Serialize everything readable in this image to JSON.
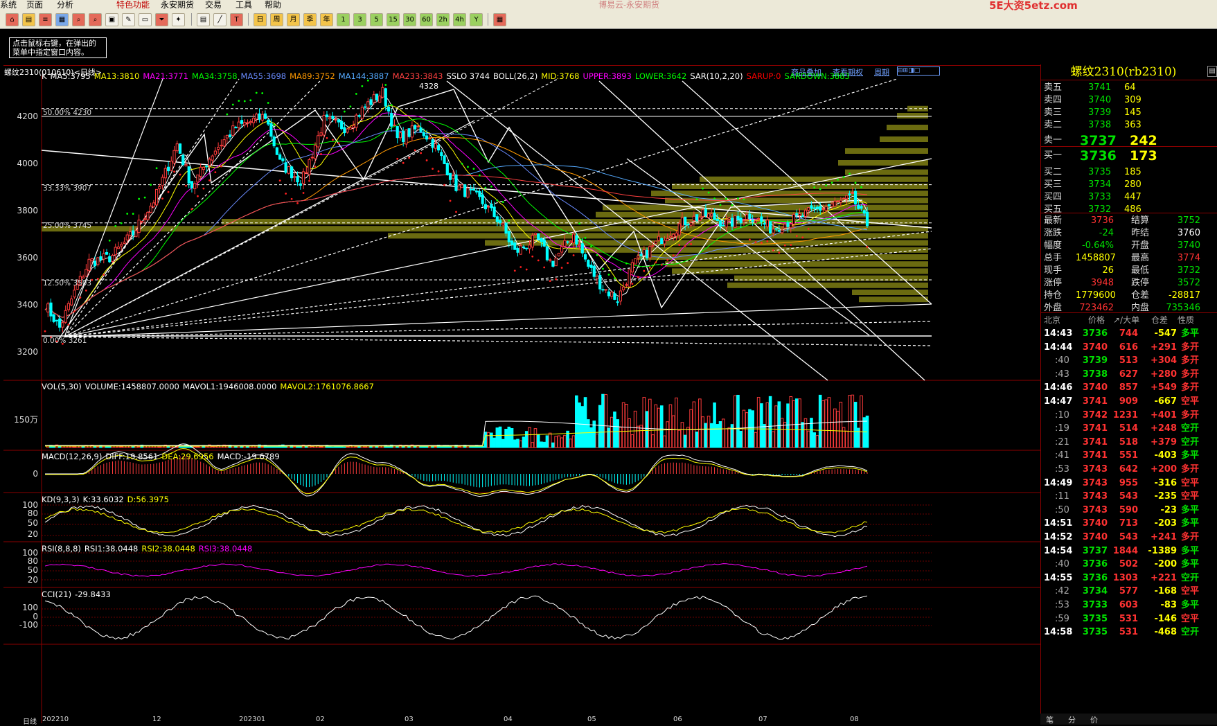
{
  "menu": [
    "系统",
    "页面",
    "分析",
    "特色功能",
    "永安期货",
    "交易",
    "工具",
    "帮助"
  ],
  "app_title": "博易云-永安期货",
  "watermark": "5E大资5etz.com",
  "toolbar_period_buttons": [
    "日",
    "周",
    "月",
    "季",
    "年",
    "1",
    "3",
    "5",
    "15",
    "30",
    "60",
    "2h",
    "4h",
    "Y"
  ],
  "hint": "点击鼠标右键，在弹出的菜单中指定窗口内容。",
  "chart_header": {
    "symbol": "螺纹2310(010610)<日线>",
    "links": [
      "商品叠加",
      "查看期权",
      "周期"
    ]
  },
  "main_indicators": [
    {
      "text": "K",
      "color": "#ffffff"
    },
    {
      "text": "MA5:3795",
      "color": "#ffffff"
    },
    {
      "text": "MA13:3810",
      "color": "#ffff00"
    },
    {
      "text": "MA21:3771",
      "color": "#ff00ff"
    },
    {
      "text": "MA34:3758",
      "color": "#00ff00"
    },
    {
      "text": "MA55:3698",
      "color": "#6a8cff"
    },
    {
      "text": "MA89:3752",
      "color": "#ff9900"
    },
    {
      "text": "MA144:3887",
      "color": "#55aaff"
    },
    {
      "text": "MA233:3843",
      "color": "#ff4040"
    },
    {
      "text": "SSLO 3744",
      "color": "#ffffff"
    },
    {
      "text": "BOLL(26,2)",
      "color": "#ffffff"
    },
    {
      "text": "MID:3768",
      "color": "#ffff00"
    },
    {
      "text": "UPPER:3893",
      "color": "#ff00ff"
    },
    {
      "text": "LOWER:3642",
      "color": "#00ff00"
    },
    {
      "text": "SAR(10,2,20)",
      "color": "#ffffff"
    },
    {
      "text": "SARUP:0",
      "color": "#ff0000"
    },
    {
      "text": "SARDOWN:3883",
      "color": "#00ff00"
    }
  ],
  "price_axis": [
    "4200",
    "4000",
    "3800",
    "3600",
    "3400",
    "3200"
  ],
  "fib_labels": [
    {
      "text": "50.00%  4230"
    },
    {
      "text": "33.33%  3907"
    },
    {
      "text": "25.00%  3745"
    },
    {
      "text": "12.50%  3503"
    },
    {
      "text": "0.00%   3261"
    }
  ],
  "peak_label": "4328",
  "volume": {
    "legend": [
      {
        "text": "VOL(5,30)",
        "color": "#ffffff"
      },
      {
        "text": "VOLUME:1458807.0000",
        "color": "#ffffff"
      },
      {
        "text": "MAVOL1:1946008.0000",
        "color": "#ffffff"
      },
      {
        "text": "MAVOL2:1761076.8667",
        "color": "#ffff00"
      }
    ],
    "axis": "150万"
  },
  "macd": {
    "legend": [
      {
        "text": "MACD(12,26,9)",
        "color": "#ffffff"
      },
      {
        "text": "DIFF:19.8561",
        "color": "#ffffff"
      },
      {
        "text": "DEA:29.6956",
        "color": "#ffff00"
      },
      {
        "text": "MACD:-19.6789",
        "color": "#ffffff"
      }
    ],
    "axis": "0"
  },
  "kd": {
    "legend": [
      {
        "text": "KD(9,3,3)",
        "color": "#ffffff"
      },
      {
        "text": "K:33.6032",
        "color": "#ffffff"
      },
      {
        "text": "D:56.3975",
        "color": "#ffff00"
      }
    ],
    "axis": [
      "100",
      "80",
      "50",
      "20"
    ]
  },
  "rsi": {
    "legend": [
      {
        "text": "RSI(8,8,8)",
        "color": "#ffffff"
      },
      {
        "text": "RSI1:38.0448",
        "color": "#ffffff"
      },
      {
        "text": "RSI2:38.0448",
        "color": "#ffff00"
      },
      {
        "text": "RSI3:38.0448",
        "color": "#ff00ff"
      }
    ],
    "axis": [
      "100",
      "80",
      "50",
      "20"
    ]
  },
  "cci": {
    "legend": [
      {
        "text": "CCI(21)",
        "color": "#ffffff"
      },
      {
        "text": "-29.8433",
        "color": "#ffffff"
      }
    ],
    "axis": [
      "100",
      "0",
      "-100"
    ]
  },
  "time_axis": [
    "日线",
    "202210",
    "12",
    "202301",
    "02",
    "03",
    "04",
    "05",
    "06",
    "07",
    "08"
  ],
  "quote": {
    "title": "螺纹2310(rb2310)",
    "asks": [
      {
        "label": "卖五",
        "price": "3741",
        "vol": "64"
      },
      {
        "label": "卖四",
        "price": "3740",
        "vol": "309"
      },
      {
        "label": "卖三",
        "price": "3739",
        "vol": "145"
      },
      {
        "label": "卖二",
        "price": "3738",
        "vol": "363"
      },
      {
        "label": "卖一",
        "price": "3737",
        "vol": "242"
      }
    ],
    "bids": [
      {
        "label": "买一",
        "price": "3736",
        "vol": "173"
      },
      {
        "label": "买二",
        "price": "3735",
        "vol": "185"
      },
      {
        "label": "买三",
        "price": "3734",
        "vol": "280"
      },
      {
        "label": "买四",
        "price": "3733",
        "vol": "447"
      },
      {
        "label": "买五",
        "price": "3732",
        "vol": "486"
      }
    ],
    "stats": [
      {
        "l1": "最新",
        "v1": "3736",
        "c1": "#ff3232",
        "l2": "结算",
        "v2": "3752",
        "c2": "#00e000"
      },
      {
        "l1": "涨跌",
        "v1": "-24",
        "c1": "#00e000",
        "l2": "昨结",
        "v2": "3760",
        "c2": "#ffffff"
      },
      {
        "l1": "幅度",
        "v1": "-0.64%",
        "c1": "#00e000",
        "l2": "开盘",
        "v2": "3740",
        "c2": "#00e000"
      },
      {
        "l1": "总手",
        "v1": "1458807",
        "c1": "#ffff00",
        "l2": "最高",
        "v2": "3774",
        "c2": "#ff3232"
      },
      {
        "l1": "现手",
        "v1": "26",
        "c1": "#ffff00",
        "l2": "最低",
        "v2": "3732",
        "c2": "#00e000"
      },
      {
        "l1": "涨停",
        "v1": "3948",
        "c1": "#ff3232",
        "l2": "跌停",
        "v2": "3572",
        "c2": "#00e000"
      },
      {
        "l1": "持仓",
        "v1": "1779600",
        "c1": "#ffff00",
        "l2": "仓差",
        "v2": "-28817",
        "c2": "#ffff00"
      },
      {
        "l1": "外盘",
        "v1": "723462",
        "c1": "#ff3232",
        "l2": "内盘",
        "v2": "735346",
        "c2": "#00e000"
      }
    ],
    "ticks_header": [
      "北京",
      "价格",
      "↗/大单",
      "仓差",
      "性质"
    ],
    "ticks": [
      {
        "t": "14:43",
        "p": "3736",
        "v": "744",
        "d": "-547",
        "n": "多平",
        "nc": "#00e000"
      },
      {
        "t": "14:44",
        "p": "3740",
        "v": "616",
        "d": "+291",
        "n": "多开",
        "nc": "#ff3232"
      },
      {
        "t": ":40",
        "p": "3739",
        "v": "513",
        "d": "+304",
        "n": "多开",
        "nc": "#ff3232"
      },
      {
        "t": ":43",
        "p": "3738",
        "v": "627",
        "d": "+280",
        "n": "多开",
        "nc": "#ff3232"
      },
      {
        "t": "14:46",
        "p": "3740",
        "v": "857",
        "d": "+549",
        "n": "多开",
        "nc": "#ff3232"
      },
      {
        "t": "14:47",
        "p": "3741",
        "v": "909",
        "d": "-667",
        "n": "空平",
        "nc": "#ff3232"
      },
      {
        "t": ":10",
        "p": "3742",
        "v": "1231",
        "d": "+401",
        "n": "多开",
        "nc": "#ff3232"
      },
      {
        "t": ":19",
        "p": "3741",
        "v": "514",
        "d": "+248",
        "n": "空开",
        "nc": "#00e000"
      },
      {
        "t": ":21",
        "p": "3741",
        "v": "518",
        "d": "+379",
        "n": "空开",
        "nc": "#00e000"
      },
      {
        "t": ":41",
        "p": "3741",
        "v": "551",
        "d": "-403",
        "n": "多平",
        "nc": "#00e000"
      },
      {
        "t": ":53",
        "p": "3743",
        "v": "642",
        "d": "+200",
        "n": "多开",
        "nc": "#ff3232"
      },
      {
        "t": "14:49",
        "p": "3743",
        "v": "955",
        "d": "-316",
        "n": "空平",
        "nc": "#ff3232"
      },
      {
        "t": ":11",
        "p": "3743",
        "v": "543",
        "d": "-235",
        "n": "空平",
        "nc": "#ff3232"
      },
      {
        "t": ":50",
        "p": "3743",
        "v": "590",
        "d": "-23",
        "n": "多平",
        "nc": "#00e000"
      },
      {
        "t": "14:51",
        "p": "3740",
        "v": "713",
        "d": "-203",
        "n": "多平",
        "nc": "#00e000"
      },
      {
        "t": "14:52",
        "p": "3740",
        "v": "543",
        "d": "+241",
        "n": "多开",
        "nc": "#ff3232"
      },
      {
        "t": "14:54",
        "p": "3737",
        "v": "1844",
        "d": "-1389",
        "n": "多平",
        "nc": "#00e000"
      },
      {
        "t": ":40",
        "p": "3736",
        "v": "502",
        "d": "-200",
        "n": "多平",
        "nc": "#00e000"
      },
      {
        "t": "14:55",
        "p": "3736",
        "v": "1303",
        "d": "+221",
        "n": "空开",
        "nc": "#00e000"
      },
      {
        "t": ":42",
        "p": "3734",
        "v": "577",
        "d": "-168",
        "n": "空平",
        "nc": "#ff3232"
      },
      {
        "t": ":53",
        "p": "3733",
        "v": "603",
        "d": "-83",
        "n": "多平",
        "nc": "#00e000"
      },
      {
        "t": ":59",
        "p": "3735",
        "v": "531",
        "d": "-146",
        "n": "空平",
        "nc": "#ff3232"
      },
      {
        "t": "14:58",
        "p": "3735",
        "v": "531",
        "d": "-468",
        "n": "空开",
        "nc": "#00e000"
      }
    ],
    "bottom_tabs": [
      "笔",
      "分",
      "价"
    ]
  }
}
